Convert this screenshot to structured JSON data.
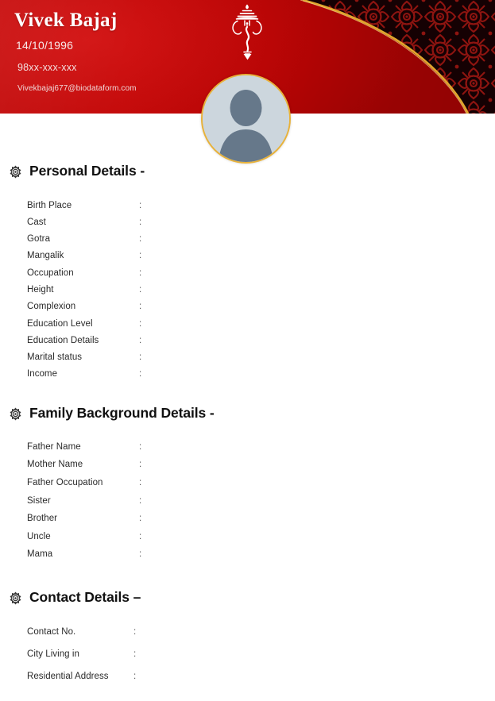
{
  "header": {
    "name": "Vivek Bajaj",
    "dob": "14/10/1996",
    "phone": "98xx-xxx-xxx",
    "email": "Vivekbajaj677@biodataform.com",
    "ganesha_icon": "ganesha-icon",
    "avatar_icon": "avatar-placeholder-icon",
    "colors": {
      "banner_red": "#c00000",
      "damask_dark": "#1b0204",
      "damask_red": "#8e1410",
      "gold_line": "#e0a72c",
      "avatar_ring": "#e8b23a",
      "avatar_fill": "#ccd6dd",
      "avatar_silhouette": "#66788a"
    }
  },
  "sections": [
    {
      "id": "personal",
      "icon": "gear-icon",
      "title": "Personal Details -",
      "fields": [
        {
          "label": "Birth Place",
          "colon": ":",
          "value": ""
        },
        {
          "label": "Cast",
          "colon": ":",
          "value": ""
        },
        {
          "label": "Gotra",
          "colon": ":",
          "value": ""
        },
        {
          "label": "Mangalik",
          "colon": ":",
          "value": ""
        },
        {
          "label": "Occupation",
          "colon": ":",
          "value": ""
        },
        {
          "label": "Height",
          "colon": ":",
          "value": ""
        },
        {
          "label": "Complexion",
          "colon": ":",
          "value": ""
        },
        {
          "label": "Education Level",
          "colon": ":",
          "value": ""
        },
        {
          "label": "Education Details",
          "colon": ":",
          "value": ""
        },
        {
          "label": "Marital status",
          "colon": ":",
          "value": ""
        },
        {
          "label": "Income",
          "colon": ":",
          "value": ""
        }
      ]
    },
    {
      "id": "family",
      "icon": "gear-icon",
      "title": "Family Background Details -",
      "fields": [
        {
          "label": "Father Name",
          "colon": ":",
          "value": ""
        },
        {
          "label": "Mother Name",
          "colon": ":",
          "value": ""
        },
        {
          "label": "Father Occupation",
          "colon": ":",
          "value": ""
        },
        {
          "label": "Sister",
          "colon": ":",
          "value": ""
        },
        {
          "label": "Brother",
          "colon": ":",
          "value": ""
        },
        {
          "label": "Uncle",
          "colon": ":",
          "value": ""
        },
        {
          "label": "Mama",
          "colon": ":",
          "value": ""
        }
      ]
    },
    {
      "id": "contact",
      "icon": "gear-icon",
      "title": "Contact Details –",
      "fields": [
        {
          "label": "Contact No.",
          "colon": ":",
          "value": ""
        },
        {
          "label": "City Living in",
          "colon": ":",
          "value": ""
        },
        {
          "label": "Residential Address",
          "colon": ":",
          "value": ""
        }
      ]
    }
  ]
}
